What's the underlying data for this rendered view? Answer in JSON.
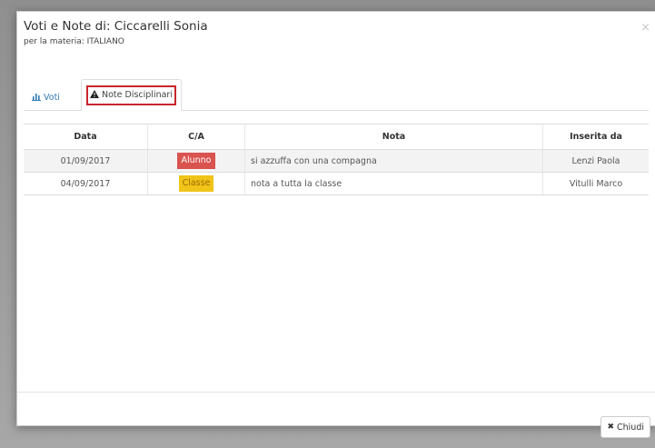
{
  "modal": {
    "title": "Voti e Note di: Ciccarelli Sonia",
    "subtitle": "per la materia: ITALIANO",
    "close_glyph": "×"
  },
  "tabs": [
    {
      "label": "Voti",
      "icon": "bar-chart-icon",
      "active": false
    },
    {
      "label": "Note Disciplinari",
      "icon": "warning-icon",
      "active": true
    }
  ],
  "table": {
    "columns": [
      "Data",
      "C/A",
      "Nota",
      "Inserita da"
    ],
    "rows": [
      {
        "data": "01/09/2017",
        "ca": "Alunno",
        "ca_type": "alunno",
        "nota": "si azzuffa con una compagna",
        "inserita_da": "Lenzi Paola"
      },
      {
        "data": "04/09/2017",
        "ca": "Classe",
        "ca_type": "classe",
        "nota": "nota a tutta la classe",
        "inserita_da": "Vitulli Marco"
      }
    ]
  },
  "footer": {
    "close_label": "Chiudi",
    "close_icon": "x-icon"
  },
  "colors": {
    "accent_link": "#337ab7",
    "highlight_border": "#c9252c",
    "badge_alunno": "#d9534f",
    "badge_classe": "#f0c419"
  }
}
